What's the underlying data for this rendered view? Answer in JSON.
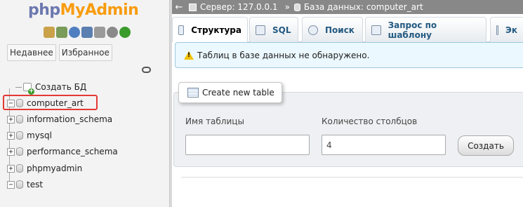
{
  "logo": {
    "part1": "php",
    "part2": "MyAdmin"
  },
  "nav_icons": [
    {
      "name": "home-icon",
      "color": "#c9a24a"
    },
    {
      "name": "exit-icon",
      "color": "#7a9b5a"
    },
    {
      "name": "help-icon",
      "color": "#4f7fc0"
    },
    {
      "name": "docs-icon",
      "color": "#5a7fb0"
    },
    {
      "name": "console-icon",
      "color": "#9a9a9a"
    },
    {
      "name": "settings-icon",
      "color": "#8a8a8a"
    },
    {
      "name": "reload-icon",
      "color": "#3a9b2a"
    }
  ],
  "nav_tabs": {
    "recent": "Недавнее",
    "favorites": "Избранное"
  },
  "tree": {
    "create_db": "Создать БД",
    "databases": [
      {
        "name": "computer_art",
        "expander": "−",
        "selected": true
      },
      {
        "name": "information_schema",
        "expander": "+"
      },
      {
        "name": "mysql",
        "expander": "+"
      },
      {
        "name": "performance_schema",
        "expander": "+"
      },
      {
        "name": "phpmyadmin",
        "expander": "+"
      },
      {
        "name": "test",
        "expander": "−"
      }
    ]
  },
  "breadcrumb": {
    "back": "←",
    "server": "Сервер: 127.0.0.1",
    "separator": "»",
    "database": "База данных: computer_art"
  },
  "tabs": [
    {
      "label": "Структура",
      "active": true,
      "icon": "structure-icon"
    },
    {
      "label": "SQL",
      "icon": "sql-icon"
    },
    {
      "label": "Поиск",
      "icon": "search-icon"
    },
    {
      "label": "Запрос по шаблону",
      "icon": "query-icon"
    },
    {
      "label": "Эк",
      "icon": "export-icon"
    }
  ],
  "notice": "Таблиц в базе данных не обнаружено.",
  "create_table": {
    "legend": "Create new table",
    "name_label": "Имя таблицы",
    "name_value": "",
    "columns_label": "Количество столбцов",
    "columns_value": "4",
    "button": "Создать"
  }
}
